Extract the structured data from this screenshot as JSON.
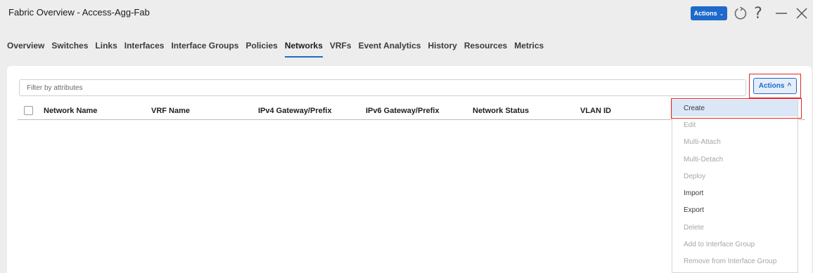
{
  "header": {
    "title": "Fabric Overview - Access-Agg-Fab",
    "actions_label": "Actions",
    "help_label": "?"
  },
  "tabs": [
    {
      "label": "Overview",
      "active": false
    },
    {
      "label": "Switches",
      "active": false
    },
    {
      "label": "Links",
      "active": false
    },
    {
      "label": "Interfaces",
      "active": false
    },
    {
      "label": "Interface Groups",
      "active": false
    },
    {
      "label": "Policies",
      "active": false
    },
    {
      "label": "Networks",
      "active": true
    },
    {
      "label": "VRFs",
      "active": false
    },
    {
      "label": "Event Analytics",
      "active": false
    },
    {
      "label": "History",
      "active": false
    },
    {
      "label": "Resources",
      "active": false
    },
    {
      "label": "Metrics",
      "active": false
    }
  ],
  "filter": {
    "placeholder": "Filter by attributes"
  },
  "actions_button": {
    "label": "Actions",
    "chevron": "^"
  },
  "table": {
    "columns": [
      "Network Name",
      "VRF Name",
      "IPv4 Gateway/Prefix",
      "IPv6 Gateway/Prefix",
      "Network Status",
      "VLAN ID"
    ]
  },
  "menu": {
    "items": [
      {
        "label": "Create",
        "enabled": true,
        "selected": true
      },
      {
        "label": "Edit",
        "enabled": false
      },
      {
        "label": "Multi-Attach",
        "enabled": false
      },
      {
        "label": "Multi-Detach",
        "enabled": false
      },
      {
        "label": "Deploy",
        "enabled": false
      },
      {
        "label": "Import",
        "enabled": true
      },
      {
        "label": "Export",
        "enabled": true
      },
      {
        "label": "Delete",
        "enabled": false
      },
      {
        "label": "Add to Interface Group",
        "enabled": false
      },
      {
        "label": "Remove from Interface Group",
        "enabled": false
      }
    ]
  },
  "icons": {
    "top_actions_chevron": "chevron-down-icon",
    "refresh": "refresh-icon",
    "help": "help-icon",
    "minimize": "minimize-icon",
    "close": "close-icon",
    "actions_chevron": "chevron-up-icon"
  },
  "colors": {
    "accent": "#1d69cc",
    "highlight_box": "#e0262b",
    "selected_menu_bg": "#dbe6f7"
  }
}
